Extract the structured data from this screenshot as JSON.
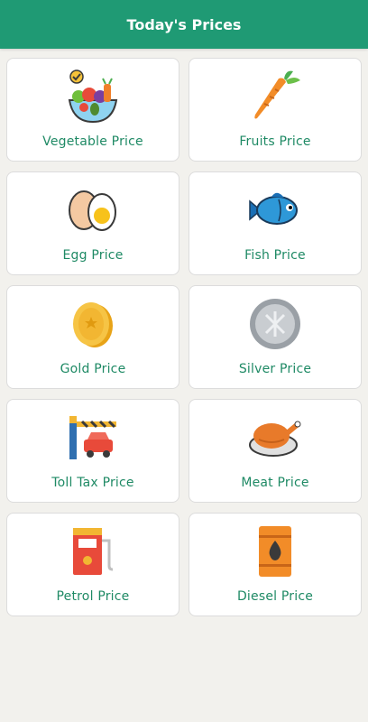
{
  "appbar": {
    "title": "Today's Prices"
  },
  "colors": {
    "primary": "#1f9a74",
    "label": "#1f8a65",
    "background": "#f2f1ed"
  },
  "items": [
    {
      "label": "Vegetable Price",
      "icon": "vegetable-basket-icon"
    },
    {
      "label": "Fruits Price",
      "icon": "carrot-icon"
    },
    {
      "label": "Egg Price",
      "icon": "egg-icon"
    },
    {
      "label": "Fish Price",
      "icon": "fish-icon"
    },
    {
      "label": "Gold Price",
      "icon": "gold-coin-icon"
    },
    {
      "label": "Silver Price",
      "icon": "silver-coin-icon"
    },
    {
      "label": "Toll Tax Price",
      "icon": "toll-gate-icon"
    },
    {
      "label": "Meat Price",
      "icon": "roast-chicken-icon"
    },
    {
      "label": "Petrol Price",
      "icon": "fuel-pump-icon"
    },
    {
      "label": "Diesel Price",
      "icon": "oil-barrel-icon"
    }
  ]
}
